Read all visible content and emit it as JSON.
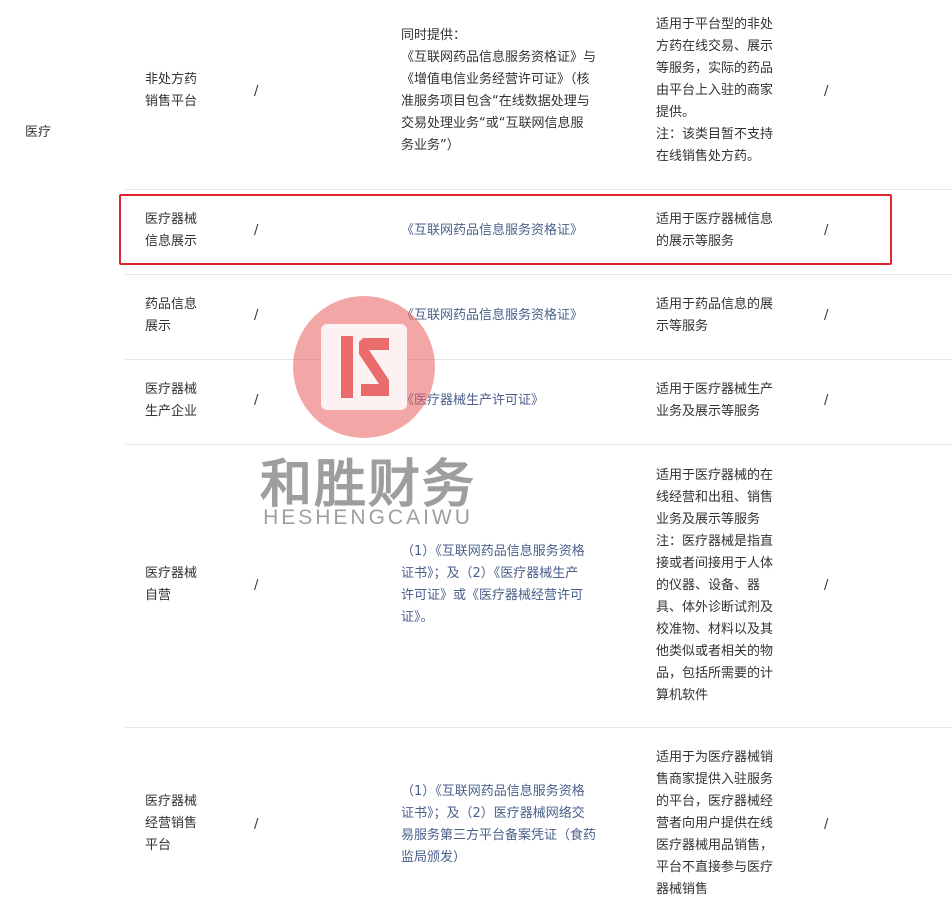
{
  "category": "医疗",
  "rows": [
    {
      "name_lines": [
        "非处方药",
        "销售平台"
      ],
      "req1": "/",
      "license_lines": [
        "同时提供：",
        "《互联网药品信息服务资格证》与",
        "《增值电信业务经营许可证》（核",
        "准服务项目包含“在线数据处理与",
        "交易处理业务“或“互联网信息服",
        "务业务”）"
      ],
      "scope_lines": [
        "适用于平台型的非处",
        "方药在线交易、展示",
        "等服务，实际的药品",
        "由平台上入驻的商家",
        "提供。",
        "注：该类目暂不支持",
        "在线销售处方药。"
      ],
      "req2": "/"
    },
    {
      "name_lines": [
        "医疗器械",
        "信息展示"
      ],
      "req1": "/",
      "license_lines": [
        "《互联网药品信息服务资格证》"
      ],
      "scope_lines": [
        "适用于医疗器械信息",
        "的展示等服务"
      ],
      "req2": "/"
    },
    {
      "name_lines": [
        "药品信息",
        "展示"
      ],
      "req1": "/",
      "license_lines": [
        "《互联网药品信息服务资格证》"
      ],
      "scope_lines": [
        "适用于药品信息的展",
        "示等服务"
      ],
      "req2": "/"
    },
    {
      "name_lines": [
        "医疗器械",
        "生产企业"
      ],
      "req1": "/",
      "license_lines": [
        "《医疗器械生产许可证》"
      ],
      "scope_lines": [
        "适用于医疗器械生产",
        "业务及展示等服务"
      ],
      "req2": "/"
    },
    {
      "name_lines": [
        "医疗器械",
        "自营"
      ],
      "req1": "/",
      "license_lines": [
        "（1）《互联网药品信息服务资格",
        "证书》；及（2）《医疗器械生产",
        "许可证》或《医疗器械经营许可",
        "证》。"
      ],
      "scope_lines": [
        "适用于医疗器械的在",
        "线经营和出租、销售",
        "业务及展示等服务",
        "注：医疗器械是指直",
        "接或者间接用于人体",
        "的仪器、设备、器",
        "具、体外诊断试剂及",
        "校准物、材料以及其",
        "他类似或者相关的物",
        "品，包括所需要的计",
        "算机软件"
      ],
      "req2": "/"
    },
    {
      "name_lines": [
        "医疗器械",
        "经营销售",
        "平台"
      ],
      "req1": "/",
      "license_lines": [
        "（1）《互联网药品信息服务资格",
        "证书》；及（2）医疗器械网络交",
        "易服务第三方平台备案凭证（食药",
        "监局颁发）"
      ],
      "scope_lines": [
        "适用于为医疗器械销",
        "售商家提供入驻服务",
        "的平台，医疗器械经",
        "营者向用户提供在线",
        "医疗器械用品销售，",
        "平台不直接参与医疗",
        "器械销售"
      ],
      "req2": "/"
    }
  ],
  "watermark": {
    "title": "和胜财务",
    "subtitle": "HESHENGCAIWU",
    "color": "#e85c5c"
  },
  "highlight_color": "#e0252f"
}
